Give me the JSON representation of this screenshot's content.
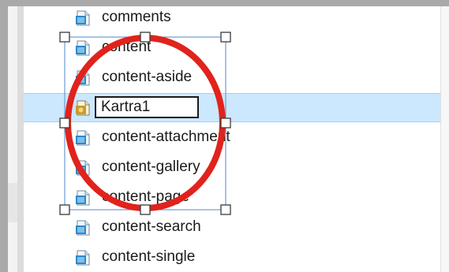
{
  "explorer": {
    "files": [
      {
        "label": "comments",
        "icon": "php-file-icon",
        "selected": false
      },
      {
        "label": "content",
        "icon": "php-file-icon",
        "selected": false
      },
      {
        "label": "content-aside",
        "icon": "php-file-icon",
        "selected": false
      },
      {
        "label": "",
        "icon": "image-file-icon",
        "selected": true,
        "rename_value": "Kartra1"
      },
      {
        "label": "content-attachment",
        "icon": "php-file-icon",
        "selected": false
      },
      {
        "label": "content-gallery",
        "icon": "php-file-icon",
        "selected": false
      },
      {
        "label": "content-page",
        "icon": "php-file-icon",
        "selected": false
      },
      {
        "label": "content-search",
        "icon": "php-file-icon",
        "selected": false
      },
      {
        "label": "content-single",
        "icon": "php-file-icon",
        "selected": false
      }
    ]
  },
  "annotation": {
    "circle_color": "#e0231c",
    "handle_color": "#3a3a3a",
    "selection_frame_color": "#6d9bd1",
    "kind": "red-circle-highlight"
  },
  "colors": {
    "selected_row": "#cce8ff",
    "border": "#a9a9a9"
  }
}
